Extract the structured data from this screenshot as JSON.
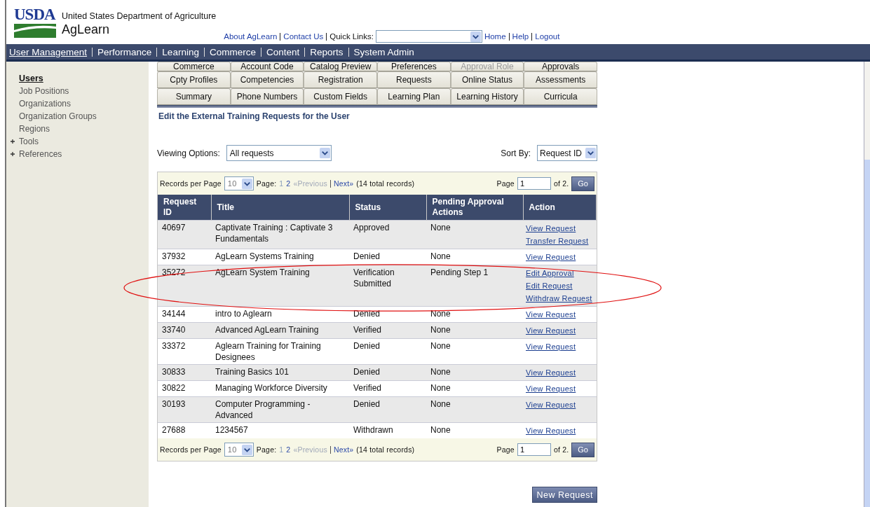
{
  "header": {
    "logo": "USDA",
    "agency": "United States Department of Agriculture",
    "app_name": "AgLearn",
    "links": [
      "About AgLearn",
      "Contact Us"
    ],
    "quick_links_label": "Quick Links:",
    "right_links": [
      "Home",
      "Help",
      "Logout"
    ]
  },
  "nav": [
    {
      "label": "User Management",
      "selected": true
    },
    {
      "label": "Performance",
      "selected": false
    },
    {
      "label": "Learning",
      "selected": false
    },
    {
      "label": "Commerce",
      "selected": false
    },
    {
      "label": "Content",
      "selected": false
    },
    {
      "label": "Reports",
      "selected": false
    },
    {
      "label": "System Admin",
      "selected": false
    }
  ],
  "sidebar": {
    "items": [
      {
        "label": "Users",
        "selected": true
      },
      {
        "label": "Job Positions",
        "selected": false
      },
      {
        "label": "Organizations",
        "selected": false
      },
      {
        "label": "Organization Groups",
        "selected": false
      },
      {
        "label": "Regions",
        "selected": false
      },
      {
        "label": "Tools",
        "selected": false,
        "expanded": false
      },
      {
        "label": "References",
        "selected": false,
        "expanded": false
      }
    ]
  },
  "tabs": [
    [
      {
        "label": "Commerce",
        "disabled": false
      },
      {
        "label": "Account Code",
        "disabled": false
      },
      {
        "label": "Catalog Preview",
        "disabled": false
      },
      {
        "label": "Preferences",
        "disabled": false
      },
      {
        "label": "Approval Role",
        "disabled": true
      },
      {
        "label": "Approvals",
        "disabled": false
      }
    ],
    [
      {
        "label": "Cpty Profiles",
        "disabled": false
      },
      {
        "label": "Competencies",
        "disabled": false
      },
      {
        "label": "Registration",
        "disabled": false
      },
      {
        "label": "Requests",
        "disabled": false
      },
      {
        "label": "Online Status",
        "disabled": false
      },
      {
        "label": "Assessments",
        "disabled": false
      }
    ],
    [
      {
        "label": "Summary",
        "disabled": false
      },
      {
        "label": "Phone Numbers",
        "disabled": false
      },
      {
        "label": "Custom Fields",
        "disabled": false
      },
      {
        "label": "Learning Plan",
        "disabled": false
      },
      {
        "label": "Learning History",
        "disabled": false
      },
      {
        "label": "Curricula",
        "disabled": false
      }
    ]
  ],
  "page_title": "Edit the External Training Requests for the User",
  "viewing_options": {
    "label": "Viewing Options:",
    "value": "All requests"
  },
  "sort_by": {
    "label": "Sort By:",
    "value": "Request ID"
  },
  "pager_top": {
    "records_label": "Records per Page",
    "per_page": "10",
    "page_label": "Page:",
    "pages": [
      {
        "label": "1",
        "selected": true
      },
      {
        "label": "2",
        "selected": false
      }
    ],
    "previous": {
      "label": "«Previous",
      "disabled": true
    },
    "next": {
      "label": "Next»",
      "disabled": false
    },
    "total": "(14 total records)",
    "goto_label": "Page",
    "goto_value": "1",
    "of": "of 2.",
    "go": "Go"
  },
  "table": {
    "columns": [
      "Request ID",
      "Title",
      "Status",
      "Pending Approval Actions",
      "Action"
    ],
    "rows": [
      {
        "id": "40697",
        "title": "Captivate Training : Captivate 3 Fundamentals",
        "status": "Approved",
        "pending": "None",
        "actions": [
          "View Request",
          "Transfer Request"
        ],
        "circled": false
      },
      {
        "id": "37932",
        "title": "AgLearn Systems Training",
        "status": "Denied",
        "pending": "None",
        "actions": [
          "View Request"
        ],
        "circled": false
      },
      {
        "id": "35272",
        "title": "AgLearn System Training",
        "status": "Verification Submitted",
        "pending": "Pending Step 1",
        "actions": [
          "Edit Approval",
          "Edit Request",
          "Withdraw Request"
        ],
        "circled": true
      },
      {
        "id": "34144",
        "title": "intro to Aglearn",
        "status": "Denied",
        "pending": "None",
        "actions": [
          "View Request"
        ],
        "circled": false
      },
      {
        "id": "33740",
        "title": "Advanced AgLearn Training",
        "status": "Verified",
        "pending": "None",
        "actions": [
          "View Request"
        ],
        "circled": false
      },
      {
        "id": "33372",
        "title": "Aglearn Training for Training Designees",
        "status": "Denied",
        "pending": "None",
        "actions": [
          "View Request"
        ],
        "circled": false
      },
      {
        "id": "30833",
        "title": "Training Basics 101",
        "status": "Denied",
        "pending": "None",
        "actions": [
          "View Request"
        ],
        "circled": false
      },
      {
        "id": "30822",
        "title": "Managing Workforce Diversity",
        "status": "Verified",
        "pending": "None",
        "actions": [
          "View Request"
        ],
        "circled": false
      },
      {
        "id": "30193",
        "title": "Computer Programming - Advanced",
        "status": "Denied",
        "pending": "None",
        "actions": [
          "View Request"
        ],
        "circled": false
      },
      {
        "id": "27688",
        "title": "1234567",
        "status": "Withdrawn",
        "pending": "None",
        "actions": [
          "View Request"
        ],
        "circled": false
      }
    ]
  },
  "pager_bottom": {
    "records_label": "Records per Page",
    "per_page": "10",
    "page_label": "Page:",
    "pages": [
      {
        "label": "1",
        "selected": true
      },
      {
        "label": "2",
        "selected": false
      }
    ],
    "previous": {
      "label": "«Previous",
      "disabled": true
    },
    "next": {
      "label": "Next»",
      "disabled": false
    },
    "total": "(14 total records)",
    "goto_label": "Page",
    "goto_value": "1",
    "of": "of 2.",
    "go": "Go"
  },
  "new_request_button": "New Request"
}
